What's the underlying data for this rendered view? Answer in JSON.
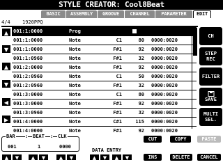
{
  "title": "STYLE CREATOR: Cool8Beat",
  "tabs": [
    {
      "label": "BASIC"
    },
    {
      "label": "ASSEMBLY"
    },
    {
      "label": "GROOVE"
    },
    {
      "label": "CHANNEL"
    },
    {
      "label": "PARAMETER"
    },
    {
      "label": "EDIT",
      "active": true
    }
  ],
  "info": {
    "position": "4/4",
    "resolution": "1920PPQ"
  },
  "events": [
    {
      "pos": "001:1:0000",
      "type": "Prog",
      "data1": "",
      "data2": "",
      "len": "",
      "selected": true,
      "icon": "ctrl-icon"
    },
    {
      "pos": "001:1:0000",
      "type": "Note",
      "data1": "C1",
      "data2": "80",
      "len": "0000:0020"
    },
    {
      "pos": "001:1:0000",
      "type": "Note",
      "data1": "F#1",
      "data2": "92",
      "len": "0000:0020"
    },
    {
      "pos": "001:1:0960",
      "type": "Note",
      "data1": "F#1",
      "data2": "32",
      "len": "0000:0020"
    },
    {
      "pos": "001:2:0000",
      "type": "Note",
      "data1": "F#1",
      "data2": "92",
      "len": "0000:0020"
    },
    {
      "pos": "001:2:0960",
      "type": "Note",
      "data1": "C1",
      "data2": "50",
      "len": "0000:0020"
    },
    {
      "pos": "001:2:0960",
      "type": "Note",
      "data1": "F#1",
      "data2": "32",
      "len": "0000:0020"
    },
    {
      "pos": "001:3:0000",
      "type": "Note",
      "data1": "C1",
      "data2": "80",
      "len": "0000:0020"
    },
    {
      "pos": "001:3:0000",
      "type": "Note",
      "data1": "F#1",
      "data2": "92",
      "len": "0000:0020"
    },
    {
      "pos": "001:3:0960",
      "type": "Note",
      "data1": "F#1",
      "data2": "32",
      "len": "0000:0020"
    },
    {
      "pos": "001:4:0000",
      "type": "Note",
      "data1": "C#1",
      "data2": "115",
      "len": "0000:0020"
    },
    {
      "pos": "001:4:0000",
      "type": "Note",
      "data1": "F#1",
      "data2": "92",
      "len": "0000:0020"
    }
  ],
  "right_buttons": [
    {
      "line1": "CH",
      "line2": ""
    },
    {
      "line1": "STEP",
      "line2": "REC"
    },
    {
      "line1": "FILTER",
      "line2": ""
    },
    {
      "line1": "SAVE",
      "line2": "",
      "icon": "save-icon"
    },
    {
      "line1": "MULTI",
      "line2": "SEL."
    }
  ],
  "left_arrows": [
    "▲",
    "▼",
    "▲",
    "▼",
    "◀",
    "▶"
  ],
  "bottom": {
    "bar_label": "BAR",
    "beat_label": "BEAT",
    "clk_label": "CLK",
    "bar_value": "001",
    "beat_value": "1",
    "clk_value": "0000",
    "data_entry": "DATA ENTRY",
    "cut": "CUT",
    "copy": "COPY",
    "paste": "PASTE",
    "ins": "INS",
    "delete": "DELETE",
    "cancel": "CANCEL"
  }
}
